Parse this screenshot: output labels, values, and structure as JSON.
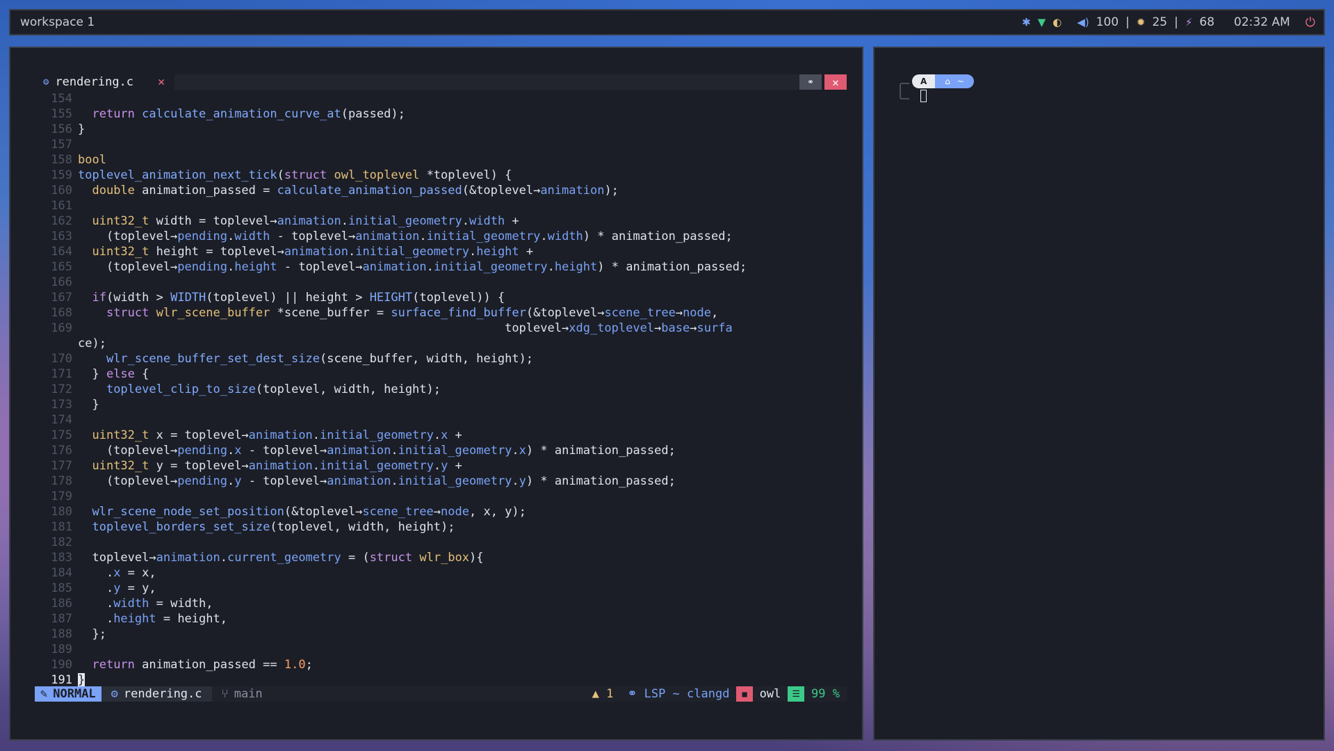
{
  "topbar": {
    "workspace": "workspace 1",
    "volume": "100",
    "brightness": "25",
    "battery": "68",
    "time": "02:32 AM",
    "sep": "|"
  },
  "editor": {
    "tab_name": "rendering.c",
    "tab_close": "✕",
    "btn_pin": "⚭",
    "btn_close": "✕",
    "status": {
      "mode": "NORMAL",
      "file": "rendering.c",
      "branch": "main",
      "warnings": "1",
      "lsp_icon": "⚭",
      "lsp": "LSP ~ clangd",
      "project": "owl",
      "percent": "99 %"
    }
  },
  "terminal": {
    "prompt_user": "Α",
    "prompt_dir": "~"
  },
  "colors": {
    "accent": "#7aa2f7",
    "keyword": "#e5c07b",
    "error": "#e05a72",
    "ok": "#3cc98a"
  },
  "code_lines": [
    {
      "n": "154",
      "t": ""
    },
    {
      "n": "155",
      "t": "  return calculate_animation_curve_at(passed);"
    },
    {
      "n": "156",
      "t": "}"
    },
    {
      "n": "157",
      "t": ""
    },
    {
      "n": "158",
      "t": "bool"
    },
    {
      "n": "159",
      "t": "toplevel_animation_next_tick(struct owl_toplevel *toplevel) {"
    },
    {
      "n": "160",
      "t": "  double animation_passed = calculate_animation_passed(&toplevel→animation);"
    },
    {
      "n": "161",
      "t": ""
    },
    {
      "n": "162",
      "t": "  uint32_t width = toplevel→animation.initial_geometry.width +"
    },
    {
      "n": "163",
      "t": "    (toplevel→pending.width - toplevel→animation.initial_geometry.width) * animation_passed;"
    },
    {
      "n": "164",
      "t": "  uint32_t height = toplevel→animation.initial_geometry.height +"
    },
    {
      "n": "165",
      "t": "    (toplevel→pending.height - toplevel→animation.initial_geometry.height) * animation_passed;"
    },
    {
      "n": "166",
      "t": ""
    },
    {
      "n": "167",
      "t": "  if(width > WIDTH(toplevel) || height > HEIGHT(toplevel)) {"
    },
    {
      "n": "168",
      "t": "    struct wlr_scene_buffer *scene_buffer = surface_find_buffer(&toplevel→scene_tree→node,"
    },
    {
      "n": "169",
      "t": "                                                            toplevel→xdg_toplevel→base→surfa"
    },
    {
      "n": "",
      "t": "ce);"
    },
    {
      "n": "170",
      "t": "    wlr_scene_buffer_set_dest_size(scene_buffer, width, height);"
    },
    {
      "n": "171",
      "t": "  } else {"
    },
    {
      "n": "172",
      "t": "    toplevel_clip_to_size(toplevel, width, height);"
    },
    {
      "n": "173",
      "t": "  }"
    },
    {
      "n": "174",
      "t": ""
    },
    {
      "n": "175",
      "t": "  uint32_t x = toplevel→animation.initial_geometry.x +"
    },
    {
      "n": "176",
      "t": "    (toplevel→pending.x - toplevel→animation.initial_geometry.x) * animation_passed;"
    },
    {
      "n": "177",
      "t": "  uint32_t y = toplevel→animation.initial_geometry.y +"
    },
    {
      "n": "178",
      "t": "    (toplevel→pending.y - toplevel→animation.initial_geometry.y) * animation_passed;"
    },
    {
      "n": "179",
      "t": ""
    },
    {
      "n": "180",
      "t": "  wlr_scene_node_set_position(&toplevel→scene_tree→node, x, y);"
    },
    {
      "n": "181",
      "t": "  toplevel_borders_set_size(toplevel, width, height);"
    },
    {
      "n": "182",
      "t": ""
    },
    {
      "n": "183",
      "t": "  toplevel→animation.current_geometry = (struct wlr_box){"
    },
    {
      "n": "184",
      "t": "    .x = x,"
    },
    {
      "n": "185",
      "t": "    .y = y,"
    },
    {
      "n": "186",
      "t": "    .width = width,"
    },
    {
      "n": "187",
      "t": "    .height = height,"
    },
    {
      "n": "188",
      "t": "  };"
    },
    {
      "n": "189",
      "t": ""
    },
    {
      "n": "190",
      "t": "  return animation_passed == 1.0;"
    },
    {
      "n": "191",
      "t": "}",
      "cursor": true
    }
  ]
}
